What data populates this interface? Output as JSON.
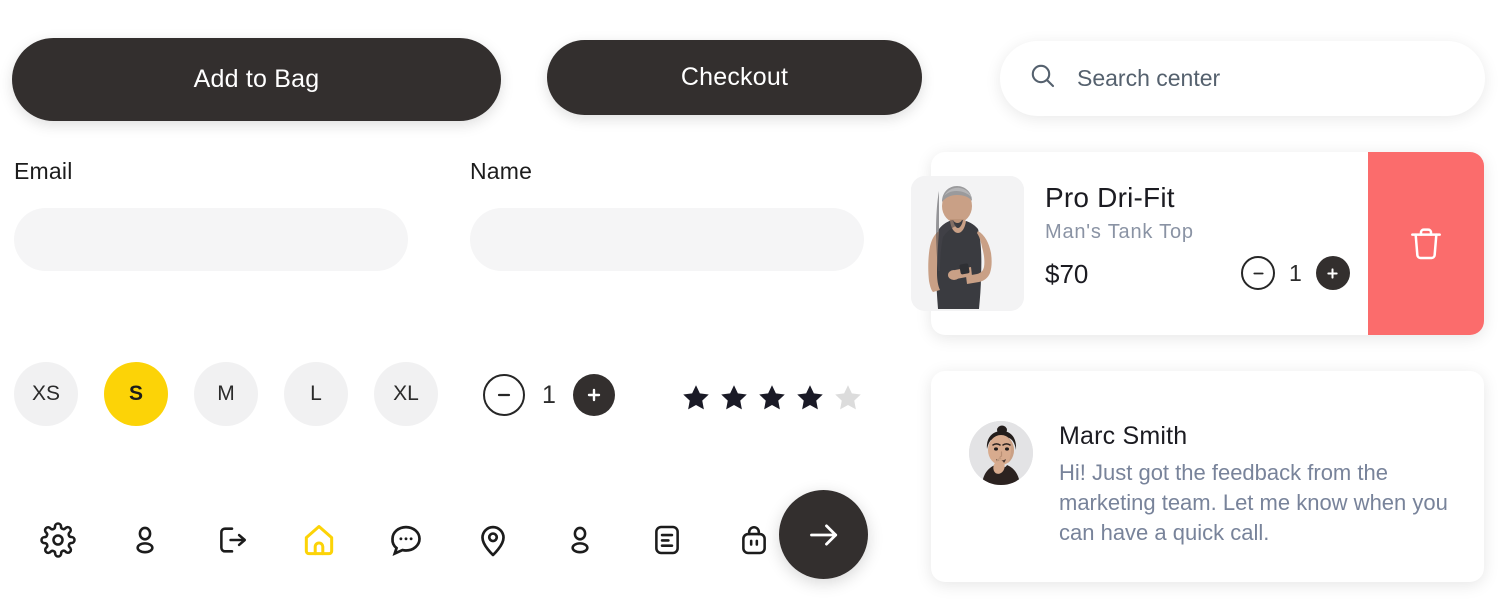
{
  "actions": {
    "add_to_bag_label": "Add to Bag",
    "checkout_label": "Checkout"
  },
  "search": {
    "placeholder": "Search center",
    "value": "",
    "icon": "search-icon"
  },
  "form": {
    "email": {
      "label": "Email",
      "value": "",
      "placeholder": ""
    },
    "name": {
      "label": "Name",
      "value": "",
      "placeholder": ""
    }
  },
  "sizes": {
    "options": [
      {
        "label": "XS",
        "selected": false
      },
      {
        "label": "S",
        "selected": true
      },
      {
        "label": "M",
        "selected": false
      },
      {
        "label": "L",
        "selected": false
      },
      {
        "label": "XL",
        "selected": false
      }
    ],
    "selected_value": "S",
    "selected_color": "#FCD307"
  },
  "quantity": {
    "value": "1",
    "minus_label": "−",
    "plus_label": "+"
  },
  "rating": {
    "filled": 4,
    "total": 5,
    "filled_color": "#1A1A26",
    "empty_color": "#DCDCDC"
  },
  "icon_bar": {
    "items": [
      {
        "name": "settings-icon",
        "active": false
      },
      {
        "name": "user-icon",
        "active": false
      },
      {
        "name": "logout-icon",
        "active": false
      },
      {
        "name": "home-icon",
        "active": true
      },
      {
        "name": "chat-icon",
        "active": false
      },
      {
        "name": "location-pin-icon",
        "active": false
      },
      {
        "name": "profile-icon",
        "active": false
      },
      {
        "name": "document-icon",
        "active": false
      },
      {
        "name": "shopping-bag-icon",
        "active": false
      }
    ],
    "active_color": "#FCD307",
    "default_color": "#1C1C1C",
    "fab": {
      "name": "arrow-right-icon",
      "background": "#332F2E"
    }
  },
  "product_card": {
    "title": "Pro Dri-Fit",
    "subtitle": "Man's Tank Top",
    "price": "$70",
    "quantity": "1",
    "minus_label": "−",
    "plus_label": "+",
    "delete_icon": "trash-icon",
    "delete_color": "#FB6C6C"
  },
  "message_card": {
    "name": "Marc Smith",
    "text": "Hi! Just got the feedback from the marketing team. Let me know when you can have a quick call.",
    "avatar": "avatar-image"
  },
  "theme": {
    "dark": "#332F2E",
    "accent_yellow": "#FCD307",
    "danger_red": "#FB6C6C",
    "field_gray": "#F5F5F6"
  }
}
